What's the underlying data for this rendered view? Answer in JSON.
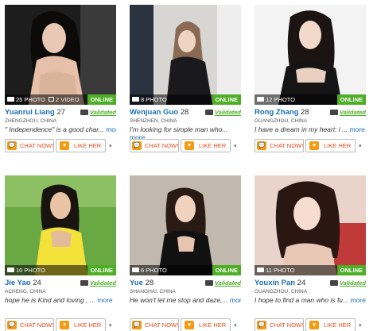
{
  "labels": {
    "online": "ONLINE",
    "validated": "Validated",
    "chat": "CHAT NOW!",
    "like": "LIKE HER",
    "more": "more",
    "caret": "▾",
    "chat_icon": "💬",
    "heart_icon": "♥"
  },
  "profiles": [
    {
      "photos": "25 PHOTO",
      "videos": "2 VIDEO",
      "name": "Yuanrui Liang",
      "age": "27",
      "location": "ZHENGZHOU, CHINA",
      "quote": "\" Independence\" is a good char...",
      "more": "more",
      "more_wrap": false
    },
    {
      "photos": "8 PHOTO",
      "name": "Wenjuan Guo",
      "age": "28",
      "location": "SHENZHEN, CHINA",
      "quote": "I'm looking for simple man who...",
      "more": "more",
      "more_wrap": true
    },
    {
      "photos": "12 PHOTO",
      "name": "Rong Zhang",
      "age": "28",
      "location": "GUANGZHOU, CHINA",
      "quote": "I have a dream in my heart: i ...",
      "more": "more",
      "more_wrap": false
    },
    {
      "photos": "10 PHOTO",
      "name": "Jie Yao",
      "age": "24",
      "location": "ACHENG, CHINA",
      "quote": "hope he is Kind and loving , ...",
      "more": "more",
      "more_wrap": false
    },
    {
      "photos": "6 PHOTO",
      "name": "Yue",
      "age": "28",
      "location": "SHANGHAI, CHINA",
      "quote": "He won't let me stop and daze,...",
      "more": "more",
      "more_wrap": false
    },
    {
      "photos": "11 PHOTO",
      "name": "Youxin Pan",
      "age": "24",
      "location": "GUANGZHOU, CHINA",
      "quote": "I hope to find a man who is fu...",
      "more": "more",
      "more_wrap": false
    }
  ],
  "colors": {
    "name_link": "#1b6fb3",
    "online_badge": "#4caf25",
    "action_orange": "#e8491d",
    "icon_orange": "#f39c12"
  }
}
